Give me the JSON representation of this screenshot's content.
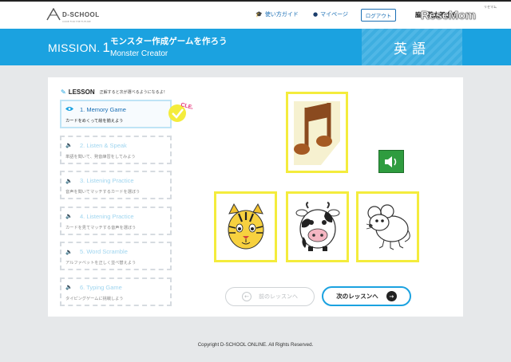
{
  "header": {
    "logo_text": "D-SCHOOL",
    "logo_tagline": "CODE FOR THE FUTURE",
    "nav": {
      "guide_label": "使い方ガイド",
      "mypage_label": "マイページ",
      "logout_label": "ログアウト"
    },
    "username": "脇　英太郎さん",
    "watermark": "ReseMom",
    "watermark_kana": "リセマム",
    "icons": {
      "guide": "graduation-cap-icon",
      "mypage": "user-icon"
    }
  },
  "mission": {
    "label": "MISSION.",
    "number": "1",
    "title": "モンスター作成ゲームを作ろう",
    "subtitle": "Monster Creator",
    "subject": "英語",
    "accent_color": "#1ba2e0"
  },
  "lessons": {
    "heading": "LESSON",
    "hint": "正解すると次が選べるようになるよ！",
    "items": [
      {
        "title": "1. Memory Game",
        "desc": "カードをめくって絵を揃えよう",
        "icon": "eye-icon",
        "status": "active",
        "badge": "CLEAR!"
      },
      {
        "title": "2. Listen & Speak",
        "desc": "単語を聞いて、発音練習をしてみよう",
        "icon": "speaker-icon",
        "status": "locked"
      },
      {
        "title": "3. Listening Practice",
        "desc": "音声を聞いてマッチするカードを選ぼう",
        "icon": "speaker-icon",
        "status": "locked"
      },
      {
        "title": "4. Listening Practice",
        "desc": "カードを見てマッチする音声を選ぼう",
        "icon": "speaker-icon",
        "status": "locked"
      },
      {
        "title": "5. Word Scramble",
        "desc": "アルファベットを正しく並べ替えよう",
        "icon": "speaker-icon",
        "status": "locked"
      },
      {
        "title": "6. Typing Game",
        "desc": "タイピングゲームに挑戦しよう",
        "icon": "speaker-icon",
        "status": "locked"
      }
    ]
  },
  "game": {
    "question_card": "music-note-icon",
    "speaker_button": "volume-icon",
    "answer_cards": [
      "tiger-icon",
      "cow-icon",
      "mouse-icon"
    ],
    "prev_label": "前のレッスンへ",
    "next_label": "次のレッスンへ",
    "card_border_color": "#f4ec3c"
  },
  "footer": {
    "copyright": "Copyright D-SCHOOL ONLINE. All Rights Reserved."
  }
}
